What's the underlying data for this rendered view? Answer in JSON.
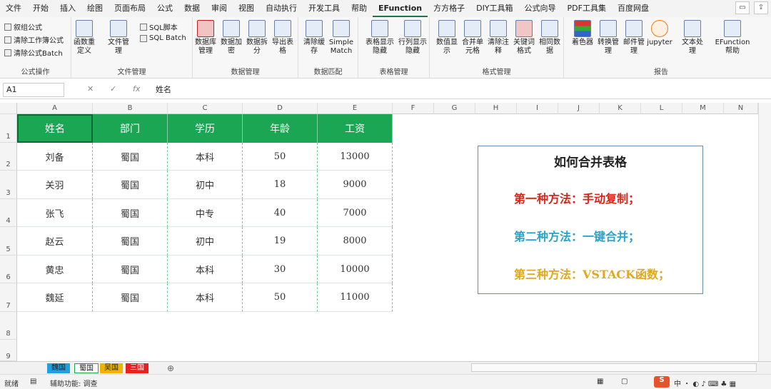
{
  "menu": [
    "文件",
    "开始",
    "插入",
    "绘图",
    "页面布局",
    "公式",
    "数据",
    "审阅",
    "视图",
    "自动执行",
    "开发工具",
    "帮助",
    "EFunction",
    "方方格子",
    "DIY工具箱",
    "公式向导",
    "PDF工具集",
    "百度网盘"
  ],
  "ribbon": {
    "g1": {
      "items": [
        "solidify-formula",
        "clear-workbook-formula",
        "clear-formula-batch"
      ],
      "labels": [
        "叙组公式",
        "清除工作簿公式",
        "清除公式Batch"
      ],
      "group": "公式操作"
    },
    "g2": {
      "labels": [
        "函数重定义",
        "文件管理",
        "SQL脚本",
        "SQL Batch"
      ],
      "group": "文件管理"
    },
    "g3": {
      "labels": [
        "数据库管理",
        "数据加密",
        "数据拆分",
        "导出表格"
      ],
      "group": "数据管理"
    },
    "g4": {
      "labels": [
        "清除缓存",
        "Simple Match"
      ],
      "group": "数据匹配"
    },
    "g5": {
      "labels": [
        "表格显示隐藏",
        "行列显示隐藏"
      ],
      "group": "表格管理"
    },
    "g6": {
      "labels": [
        "数值显示",
        "合并单元格",
        "清除注释",
        "关键词格式",
        "相同数据"
      ],
      "group": "格式管理"
    },
    "g7": {
      "labels": [
        "着色器",
        "转换管理",
        "邮件管理",
        "jupyter",
        "文本处理",
        "EFunction帮助"
      ],
      "group": "报告"
    }
  },
  "formula": {
    "cell_ref": "A1",
    "content": "姓名",
    "fx": "fx"
  },
  "columns": [
    "A",
    "B",
    "C",
    "D",
    "E",
    "F",
    "G",
    "H",
    "I",
    "J",
    "K",
    "L",
    "M",
    "N"
  ],
  "rows": [
    "1",
    "2",
    "3",
    "4",
    "5",
    "6",
    "7",
    "8",
    "9"
  ],
  "table": {
    "headers": [
      "姓名",
      "部门",
      "学历",
      "年龄",
      "工资"
    ],
    "rows": [
      [
        "刘备",
        "蜀国",
        "本科",
        "50",
        "13000"
      ],
      [
        "关羽",
        "蜀国",
        "初中",
        "18",
        "9000"
      ],
      [
        "张飞",
        "蜀国",
        "中专",
        "40",
        "7000"
      ],
      [
        "赵云",
        "蜀国",
        "初中",
        "19",
        "8000"
      ],
      [
        "黄忠",
        "蜀国",
        "本科",
        "30",
        "10000"
      ],
      [
        "魏延",
        "蜀国",
        "本科",
        "50",
        "11000"
      ]
    ]
  },
  "infobox": {
    "title": "如何合并表格",
    "line1": "第一种方法：手动复制；",
    "line2": "第二种方法：一键合并；",
    "line3": "第三种方法：VSTACK函数；",
    "colors": {
      "line1": "#d9261c",
      "line2": "#2aa3c8",
      "line3": "#e0a81a"
    }
  },
  "sheets": [
    {
      "name": "魏国",
      "color": "#1fa0e0"
    },
    {
      "name": "蜀国",
      "color": "#ffffff"
    },
    {
      "name": "吴国",
      "color": "#f0b400"
    },
    {
      "name": "三国",
      "color": "#e82020"
    }
  ],
  "status": {
    "ready": "就绪",
    "accessibility": "辅助功能: 调查"
  },
  "colors": {
    "header_green": "#1aa653"
  }
}
